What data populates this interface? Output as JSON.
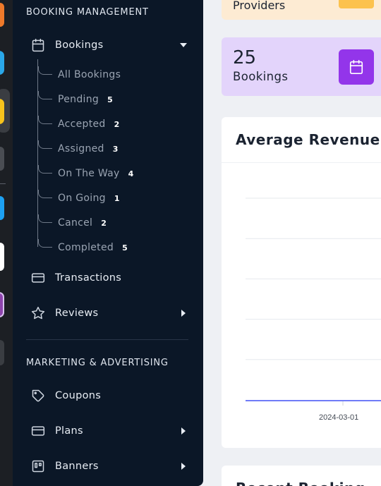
{
  "app_rail": {
    "icons": [
      {
        "name": "orange-app",
        "color": "#f07a2a"
      },
      {
        "name": "blue-app",
        "color": "#2aa7e8"
      },
      {
        "name": "yellow-app",
        "color": "#f7c31c"
      },
      {
        "name": "gray-app",
        "color": "#6a6e75"
      },
      {
        "name": "cyan-app",
        "color": "#1da1f2"
      },
      {
        "name": "white-app",
        "color": "#ffffff"
      },
      {
        "name": "purple-app",
        "color": "#8e44ad"
      },
      {
        "name": "dark-app",
        "color": "#3a3d42"
      }
    ]
  },
  "sidebar": {
    "booking_section": "BOOKING MANAGEMENT",
    "bookings": {
      "label": "Bookings",
      "icon": "calendar-icon"
    },
    "sub_items": [
      {
        "label": "All Bookings",
        "count": ""
      },
      {
        "label": "Pending",
        "count": "5"
      },
      {
        "label": "Accepted",
        "count": "2"
      },
      {
        "label": "Assigned",
        "count": "3"
      },
      {
        "label": "On The Way",
        "count": "4"
      },
      {
        "label": "On Going",
        "count": "1"
      },
      {
        "label": "Cancel",
        "count": "2"
      },
      {
        "label": "Completed",
        "count": "5"
      }
    ],
    "transactions": {
      "label": "Transactions",
      "icon": "credit-card-icon"
    },
    "reviews": {
      "label": "Reviews",
      "icon": "star-icon"
    },
    "marketing_section": "MARKETING & ADVERTISING",
    "coupons": {
      "label": "Coupons",
      "icon": "tag-icon"
    },
    "plans": {
      "label": "Plans",
      "icon": "credit-card-icon"
    },
    "banners": {
      "label": "Banners",
      "icon": "banner-icon"
    }
  },
  "cards": {
    "providers": {
      "label": "Providers",
      "color": "#fcc24e"
    },
    "bookings": {
      "value": "25",
      "label": "Bookings",
      "color": "#9335ea"
    }
  },
  "revenue": {
    "title": "Average Revenue"
  },
  "recent": {
    "title": "Recent Booking"
  },
  "chart_data": {
    "type": "line",
    "title": "Average Revenue",
    "x": [
      "2024-03-01"
    ],
    "series": [
      {
        "values": [
          0
        ]
      }
    ],
    "line_color": "#6f7bf7",
    "grid": true
  }
}
